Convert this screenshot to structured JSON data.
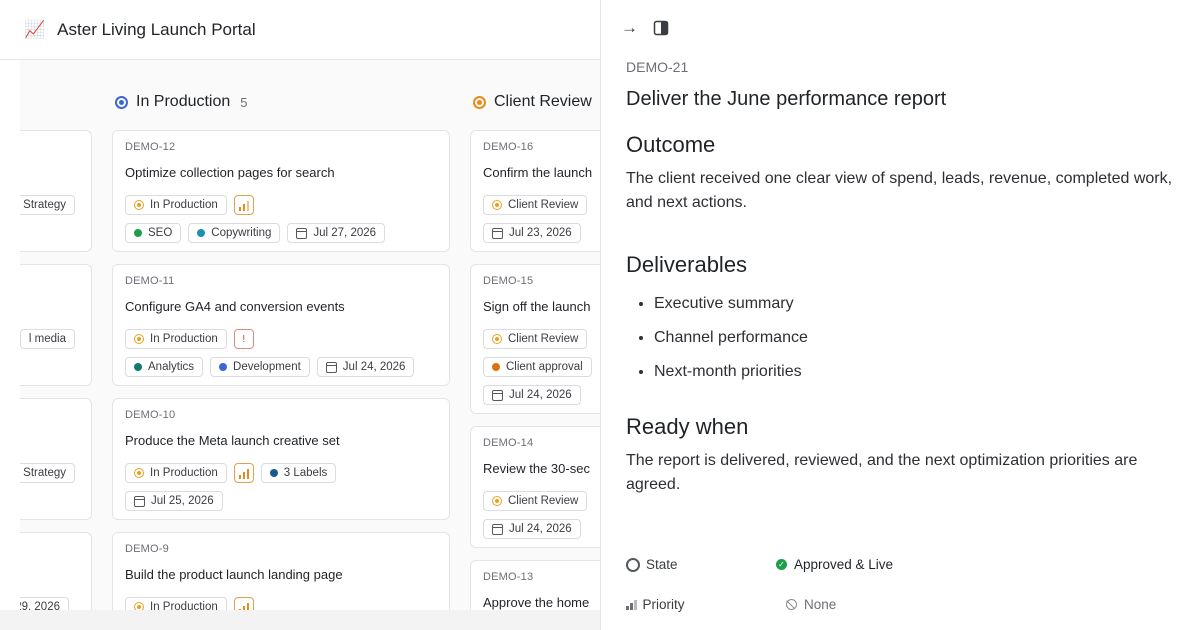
{
  "app": {
    "title": "Aster Living Launch Portal",
    "logo_icon": "chart-increasing-icon"
  },
  "columns": [
    {
      "title": "In Production",
      "count": "5",
      "color": "#3b66d6"
    },
    {
      "title": "Client Review",
      "color": "#e98a1a"
    }
  ],
  "partial_cards": [
    "Strategy",
    "l media",
    "Strategy",
    "29, 2026"
  ],
  "production_cards": [
    {
      "id": "DEMO-12",
      "title": "Optimize collection pages for search",
      "state": "In Production",
      "labels": [
        "SEO",
        "Copywriting"
      ],
      "date": "Jul 27, 2026"
    },
    {
      "id": "DEMO-11",
      "title": "Configure GA4 and conversion events",
      "state": "In Production",
      "labels": [
        "Analytics",
        "Development"
      ],
      "date": "Jul 24, 2026"
    },
    {
      "id": "DEMO-10",
      "title": "Produce the Meta launch creative set",
      "state": "In Production",
      "labels": [
        "3 Labels"
      ],
      "date": "Jul 25, 2026"
    },
    {
      "id": "DEMO-9",
      "title": "Build the product launch landing page",
      "state": "In Production"
    }
  ],
  "review_cards": [
    {
      "id": "DEMO-16",
      "title": "Confirm the launch",
      "state": "Client Review",
      "date": "Jul 23, 2026"
    },
    {
      "id": "DEMO-15",
      "title": "Sign off the launch",
      "state": "Client Review",
      "label": "Client approval",
      "date": "Jul 24, 2026"
    },
    {
      "id": "DEMO-14",
      "title": "Review the 30-sec",
      "state": "Client Review",
      "date": "Jul 24, 2026"
    },
    {
      "id": "DEMO-13",
      "title": "Approve the home"
    }
  ],
  "label_colors": {
    "SEO": "#1e9e4a",
    "Copywriting": "#1b93b0",
    "Analytics": "#0f7b6c",
    "Development": "#3b66d6",
    "3 Labels": "#1a5a8a",
    "Client approval": "#d9730d"
  },
  "detail": {
    "id": "DEMO-21",
    "title": "Deliver the June performance report",
    "outcome_heading": "Outcome",
    "outcome_text": "The client received one clear view of spend, leads, revenue, completed work, and next actions.",
    "deliverables_heading": "Deliverables",
    "deliverables": [
      "Executive summary",
      "Channel performance",
      "Next-month priorities"
    ],
    "ready_heading": "Ready when",
    "ready_text": "The report is delivered, reviewed, and the next optimization priorities are agreed.",
    "props": {
      "state_label": "State",
      "state_value": "Approved & Live",
      "priority_label": "Priority",
      "priority_value": "None"
    }
  }
}
